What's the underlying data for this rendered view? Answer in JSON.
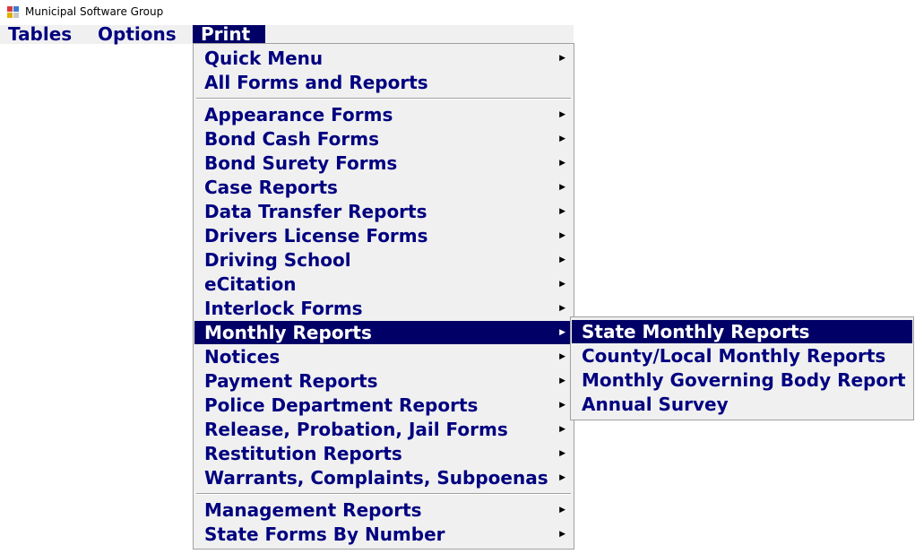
{
  "window": {
    "title": "Municipal Software Group"
  },
  "menubar": {
    "items": [
      {
        "label": "Tables"
      },
      {
        "label": "Options"
      },
      {
        "label": "Print"
      }
    ]
  },
  "print_menu": {
    "items": [
      {
        "label": "Quick Menu"
      },
      {
        "label": "All Forms and Reports"
      },
      {
        "label": "Appearance Forms"
      },
      {
        "label": "Bond Cash Forms"
      },
      {
        "label": "Bond Surety Forms"
      },
      {
        "label": "Case Reports"
      },
      {
        "label": "Data Transfer Reports"
      },
      {
        "label": "Drivers License Forms"
      },
      {
        "label": "Driving School"
      },
      {
        "label": "eCitation"
      },
      {
        "label": "Interlock Forms"
      },
      {
        "label": "Monthly Reports"
      },
      {
        "label": "Notices"
      },
      {
        "label": "Payment Reports"
      },
      {
        "label": "Police Department Reports"
      },
      {
        "label": "Release, Probation, Jail Forms"
      },
      {
        "label": "Restitution Reports"
      },
      {
        "label": "Warrants, Complaints, Subpoenas"
      },
      {
        "label": "Management Reports"
      },
      {
        "label": "State Forms By Number"
      }
    ]
  },
  "monthly_submenu": {
    "items": [
      {
        "label": "State Monthly Reports"
      },
      {
        "label": "County/Local Monthly Reports"
      },
      {
        "label": "Monthly Governing Body Report"
      },
      {
        "label": "Annual Survey"
      }
    ]
  },
  "colors": {
    "menu_text": "#000080",
    "highlight_bg": "#000066",
    "menu_bg": "#f0f0f0"
  },
  "icons": {
    "submenu_arrow": "submenu-arrow-icon",
    "app": "app-icon"
  }
}
